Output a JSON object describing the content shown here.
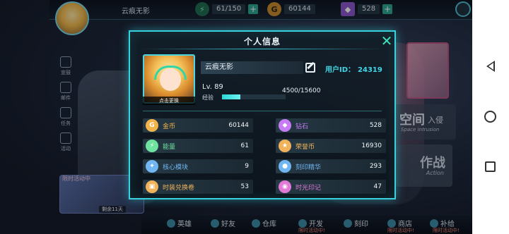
{
  "top_bar": {
    "player_name": "云痕无影",
    "energy": "61/150",
    "gold": "60144",
    "diamond": "528"
  },
  "sidebar": {
    "items": [
      {
        "label": "宣鼓"
      },
      {
        "label": "邮件"
      },
      {
        "label": "任务"
      },
      {
        "label": "活动"
      }
    ]
  },
  "event_banner": {
    "label": "限时活动中",
    "time": "剩余11天"
  },
  "background_labels": {
    "space_title": "空间",
    "space_sub": "入侵",
    "space_en": "Space intrusion",
    "action_title": "作战",
    "action_en": "Action"
  },
  "bottom_nav": {
    "items": [
      {
        "label": "英雄"
      },
      {
        "label": "好友"
      },
      {
        "label": "仓库"
      },
      {
        "label": "开发"
      },
      {
        "label": "刻印"
      },
      {
        "label": "商店"
      },
      {
        "label": "补给"
      }
    ],
    "sub_label": "限时活动中!"
  },
  "dialog": {
    "title": "个人信息",
    "change_avatar": "点击更换",
    "player_name": "云痕无影",
    "uid_label": "用户ID：",
    "uid_value": "24319",
    "level": "Lv. 89",
    "exp_label": "经验",
    "exp_text": "4500/15600",
    "exp_fraction": 0.288
  },
  "stats": [
    {
      "label": "金币",
      "value": "60144",
      "icon": "gold-coin-icon",
      "color": "#f2b44a"
    },
    {
      "label": "钻石",
      "value": "528",
      "icon": "diamond-icon",
      "color": "#c77cf6"
    },
    {
      "label": "能量",
      "value": "61",
      "icon": "energy-icon",
      "color": "#6fe2a0"
    },
    {
      "label": "荣誉币",
      "value": "16930",
      "icon": "honor-coin-icon",
      "color": "#f0b35a"
    },
    {
      "label": "核心模块",
      "value": "9",
      "icon": "core-module-icon",
      "color": "#6fb6f2"
    },
    {
      "label": "刻印精华",
      "value": "293",
      "icon": "imprint-essence-icon",
      "color": "#6fb6f2"
    },
    {
      "label": "时装兑换卷",
      "value": "53",
      "icon": "costume-ticket-icon",
      "color": "#f0b35a"
    },
    {
      "label": "时光印记",
      "value": "47",
      "icon": "time-mark-icon",
      "color": "#e07ad6"
    }
  ]
}
